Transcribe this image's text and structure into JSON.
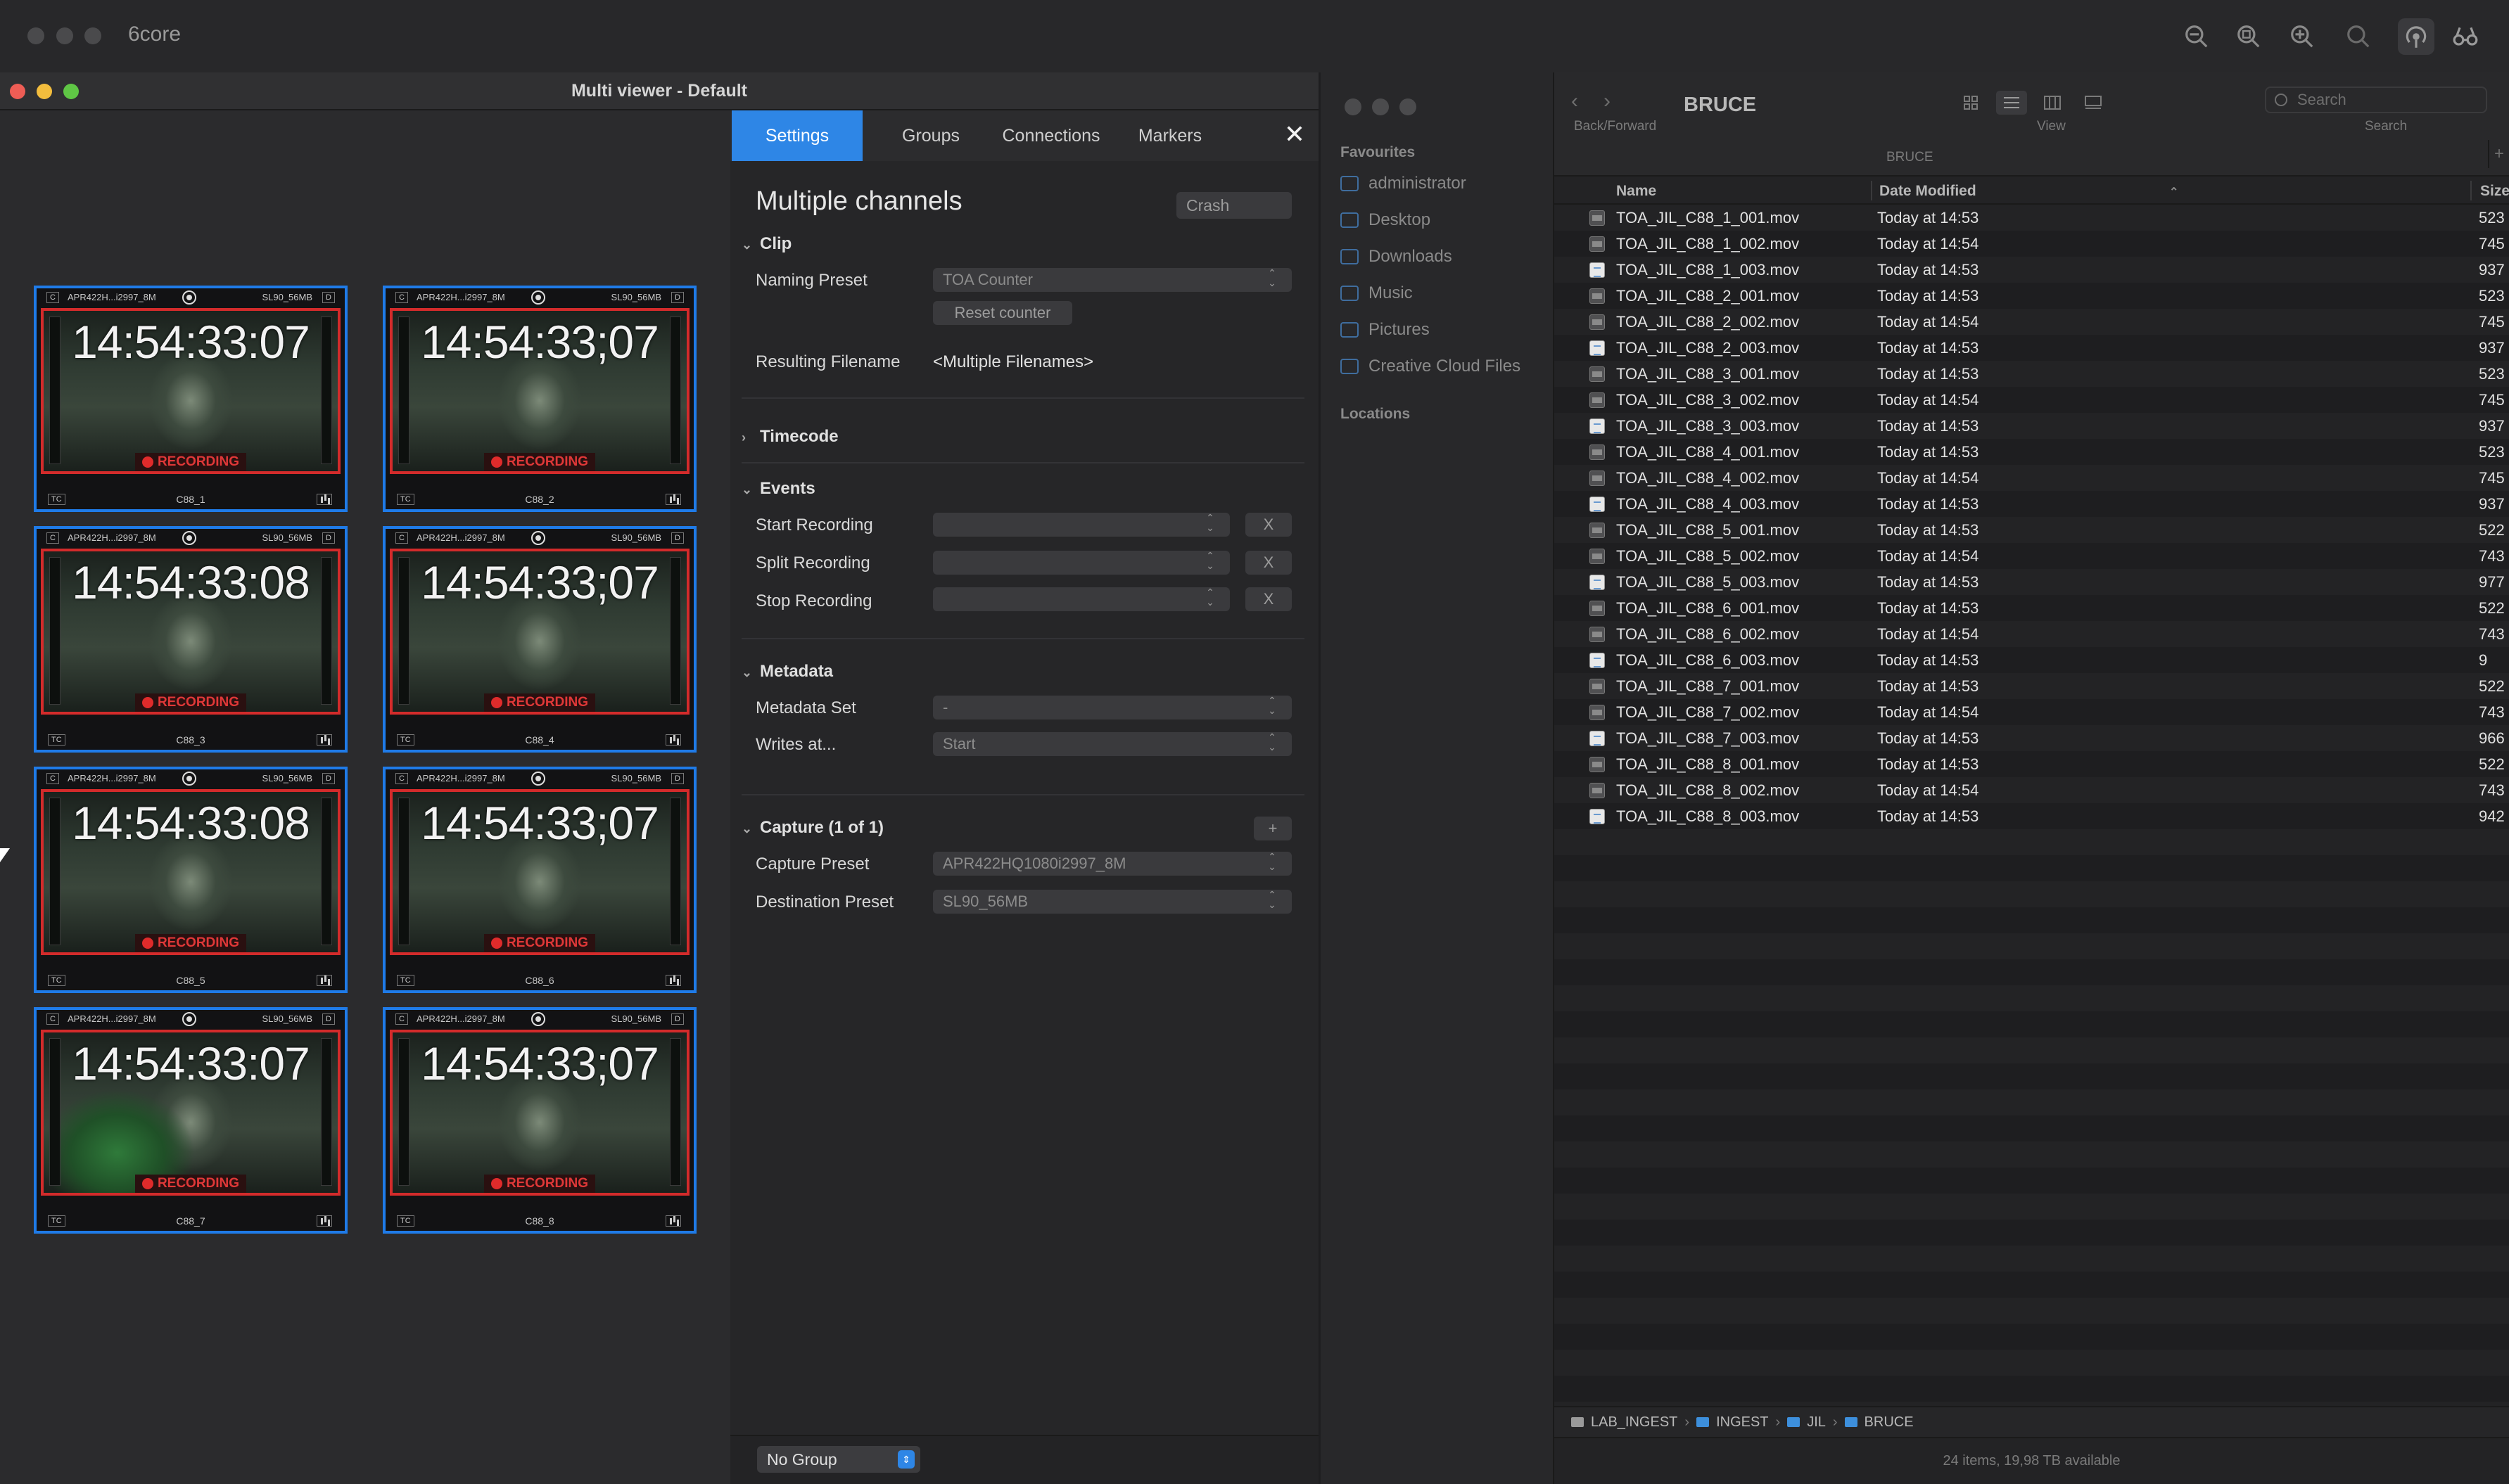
{
  "app": {
    "title": "6core"
  },
  "multiviewer": {
    "window_title": "Multi viewer - Default",
    "tiles": [
      {
        "name": "C88_1",
        "capture_preset": "APR422H...i2997_8M",
        "destination_preset": "SL90_56MB",
        "timecode": "14:54:33:07",
        "status": "RECORDING",
        "corner_left": "C",
        "corner_right": "D",
        "tc_label": "TC"
      },
      {
        "name": "C88_2",
        "capture_preset": "APR422H...i2997_8M",
        "destination_preset": "SL90_56MB",
        "timecode": "14:54:33;07",
        "status": "RECORDING",
        "corner_left": "C",
        "corner_right": "D",
        "tc_label": "TC"
      },
      {
        "name": "C88_3",
        "capture_preset": "APR422H...i2997_8M",
        "destination_preset": "SL90_56MB",
        "timecode": "14:54:33:08",
        "status": "RECORDING",
        "corner_left": "C",
        "corner_right": "D",
        "tc_label": "TC"
      },
      {
        "name": "C88_4",
        "capture_preset": "APR422H...i2997_8M",
        "destination_preset": "SL90_56MB",
        "timecode": "14:54:33;07",
        "status": "RECORDING",
        "corner_left": "C",
        "corner_right": "D",
        "tc_label": "TC"
      },
      {
        "name": "C88_5",
        "capture_preset": "APR422H...i2997_8M",
        "destination_preset": "SL90_56MB",
        "timecode": "14:54:33:08",
        "status": "RECORDING",
        "corner_left": "C",
        "corner_right": "D",
        "tc_label": "TC"
      },
      {
        "name": "C88_6",
        "capture_preset": "APR422H...i2997_8M",
        "destination_preset": "SL90_56MB",
        "timecode": "14:54:33;07",
        "status": "RECORDING",
        "corner_left": "C",
        "corner_right": "D",
        "tc_label": "TC"
      },
      {
        "name": "C88_7",
        "capture_preset": "APR422H...i2997_8M",
        "destination_preset": "SL90_56MB",
        "timecode": "14:54:33:07",
        "status": "RECORDING",
        "corner_left": "C",
        "corner_right": "D",
        "tc_label": "TC"
      },
      {
        "name": "C88_8",
        "capture_preset": "APR422H...i2997_8M",
        "destination_preset": "SL90_56MB",
        "timecode": "14:54:33;07",
        "status": "RECORDING",
        "corner_left": "C",
        "corner_right": "D",
        "tc_label": "TC"
      }
    ]
  },
  "settings": {
    "tabs": [
      "Settings",
      "Groups",
      "Connections",
      "Markers"
    ],
    "active_tab": "Settings",
    "close_label": "✕",
    "title": "Multiple channels",
    "mode_select": "Crash",
    "clip": {
      "header": "Clip",
      "naming_preset_label": "Naming Preset",
      "naming_preset_value": "TOA Counter",
      "reset_counter": "Reset counter",
      "resulting_filename_label": "Resulting Filename",
      "resulting_filename_value": "<Multiple Filenames>"
    },
    "timecode": {
      "header": "Timecode"
    },
    "events": {
      "header": "Events",
      "start_label": "Start Recording",
      "split_label": "Split Recording",
      "stop_label": "Stop Recording",
      "clear_label": "X"
    },
    "metadata": {
      "header": "Metadata",
      "set_label": "Metadata Set",
      "set_value": "-",
      "writes_label": "Writes at...",
      "writes_value": "Start"
    },
    "capture": {
      "header": "Capture (1 of 1)",
      "add_label": "+",
      "capture_preset_label": "Capture Preset",
      "capture_preset_value": "APR422HQ1080i2997_8M",
      "destination_preset_label": "Destination Preset",
      "destination_preset_value": "SL90_56MB"
    },
    "footer": {
      "group_select": "No Group"
    }
  },
  "finder": {
    "title": "BRUCE",
    "toolbar": {
      "back_forward_label": "Back/Forward",
      "view_label": "View",
      "search_label": "Search",
      "search_placeholder": "Search",
      "subtitle": "BRUCE",
      "add_label": "+"
    },
    "sidebar": {
      "favourites_header": "Favourites",
      "favourites": [
        "administrator",
        "Desktop",
        "Downloads",
        "Music",
        "Pictures",
        "Creative Cloud Files"
      ],
      "locations_header": "Locations"
    },
    "columns": {
      "name": "Name",
      "date": "Date Modified",
      "size": "Size"
    },
    "files": [
      {
        "name": "TOA_JIL_C88_1_001.mov",
        "date": "Today at 14:53",
        "size": "523",
        "kind": "mov"
      },
      {
        "name": "TOA_JIL_C88_1_002.mov",
        "date": "Today at 14:54",
        "size": "745",
        "kind": "mov"
      },
      {
        "name": "TOA_JIL_C88_1_003.mov",
        "date": "Today at 14:53",
        "size": "937",
        "kind": "doc"
      },
      {
        "name": "TOA_JIL_C88_2_001.mov",
        "date": "Today at 14:53",
        "size": "523",
        "kind": "mov"
      },
      {
        "name": "TOA_JIL_C88_2_002.mov",
        "date": "Today at 14:54",
        "size": "745",
        "kind": "mov"
      },
      {
        "name": "TOA_JIL_C88_2_003.mov",
        "date": "Today at 14:53",
        "size": "937",
        "kind": "doc"
      },
      {
        "name": "TOA_JIL_C88_3_001.mov",
        "date": "Today at 14:53",
        "size": "523",
        "kind": "mov"
      },
      {
        "name": "TOA_JIL_C88_3_002.mov",
        "date": "Today at 14:54",
        "size": "745",
        "kind": "mov"
      },
      {
        "name": "TOA_JIL_C88_3_003.mov",
        "date": "Today at 14:53",
        "size": "937",
        "kind": "doc"
      },
      {
        "name": "TOA_JIL_C88_4_001.mov",
        "date": "Today at 14:53",
        "size": "523",
        "kind": "mov"
      },
      {
        "name": "TOA_JIL_C88_4_002.mov",
        "date": "Today at 14:54",
        "size": "745",
        "kind": "mov"
      },
      {
        "name": "TOA_JIL_C88_4_003.mov",
        "date": "Today at 14:53",
        "size": "937",
        "kind": "doc"
      },
      {
        "name": "TOA_JIL_C88_5_001.mov",
        "date": "Today at 14:53",
        "size": "522",
        "kind": "mov"
      },
      {
        "name": "TOA_JIL_C88_5_002.mov",
        "date": "Today at 14:54",
        "size": "743",
        "kind": "mov"
      },
      {
        "name": "TOA_JIL_C88_5_003.mov",
        "date": "Today at 14:53",
        "size": "977",
        "kind": "doc"
      },
      {
        "name": "TOA_JIL_C88_6_001.mov",
        "date": "Today at 14:53",
        "size": "522",
        "kind": "mov"
      },
      {
        "name": "TOA_JIL_C88_6_002.mov",
        "date": "Today at 14:54",
        "size": "743",
        "kind": "mov"
      },
      {
        "name": "TOA_JIL_C88_6_003.mov",
        "date": "Today at 14:53",
        "size": "9",
        "kind": "doc"
      },
      {
        "name": "TOA_JIL_C88_7_001.mov",
        "date": "Today at 14:53",
        "size": "522",
        "kind": "mov"
      },
      {
        "name": "TOA_JIL_C88_7_002.mov",
        "date": "Today at 14:54",
        "size": "743",
        "kind": "mov"
      },
      {
        "name": "TOA_JIL_C88_7_003.mov",
        "date": "Today at 14:53",
        "size": "966",
        "kind": "doc"
      },
      {
        "name": "TOA_JIL_C88_8_001.mov",
        "date": "Today at 14:53",
        "size": "522",
        "kind": "mov"
      },
      {
        "name": "TOA_JIL_C88_8_002.mov",
        "date": "Today at 14:54",
        "size": "743",
        "kind": "mov"
      },
      {
        "name": "TOA_JIL_C88_8_003.mov",
        "date": "Today at 14:53",
        "size": "942",
        "kind": "doc"
      }
    ],
    "path": [
      "LAB_INGEST",
      "INGEST",
      "JIL",
      "BRUCE"
    ],
    "status": "24 items, 19,98 TB available"
  }
}
